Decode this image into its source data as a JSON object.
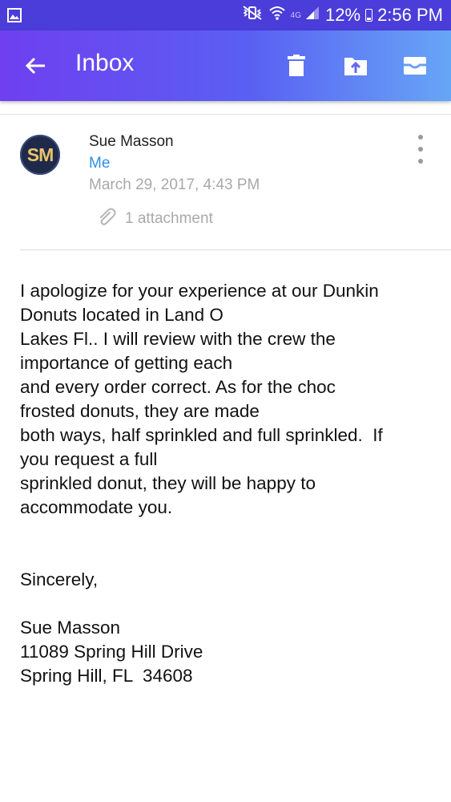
{
  "status_bar": {
    "left_icon": "image-notification-icon",
    "icons": [
      "mute-vibrate-icon",
      "wifi-icon",
      "signal-icon"
    ],
    "network": "4G",
    "battery": "12%",
    "time": "2:56 PM",
    "background": "#4a3dd9"
  },
  "appbar": {
    "title": "Inbox",
    "icons": [
      "back-arrow-icon",
      "trash-icon",
      "move-to-folder-icon",
      "archive-icon"
    ],
    "gradient": [
      "#6f3ff0",
      "#5a5ff2",
      "#66a6f6"
    ]
  },
  "message": {
    "avatar_initials": "SM",
    "sender": "Sue Masson",
    "recipient": "Me",
    "date": "March 29, 2017, 4:43 PM",
    "attachment_label": "1 attachment",
    "recipient_color": "#2f8ee8",
    "body_lines": [
      "I apologize for your experience at our Dunkin",
      "Donuts located in Land O",
      "Lakes Fl.. I will review with the crew the",
      "importance of getting each",
      "and every order correct. As for the choc",
      "frosted donuts, they are made",
      "both ways, half sprinkled and full sprinkled.  If",
      "you request a full",
      "sprinkled donut, they will be happy to",
      "accommodate you."
    ],
    "closing": "Sincerely,",
    "signature_lines": [
      "Sue Masson",
      "11089 Spring Hill Drive",
      "Spring Hill, FL  34608"
    ]
  }
}
